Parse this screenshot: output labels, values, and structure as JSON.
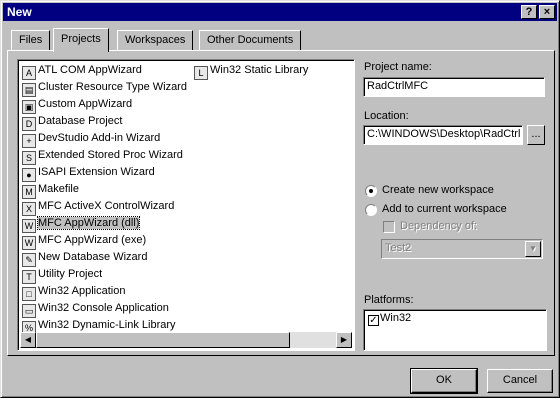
{
  "window": {
    "title": "New",
    "help_glyph": "?",
    "close_glyph": "×"
  },
  "tabs": [
    {
      "label": "Files"
    },
    {
      "label": "Projects"
    },
    {
      "label": "Workspaces"
    },
    {
      "label": "Other Documents"
    }
  ],
  "active_tab": "Projects",
  "project_types": [
    {
      "label": "ATL COM AppWizard",
      "icon": "atl-com-icon"
    },
    {
      "label": "Cluster Resource Type Wizard",
      "icon": "cluster-icon"
    },
    {
      "label": "Custom AppWizard",
      "icon": "custom-appwizard-icon"
    },
    {
      "label": "Database Project",
      "icon": "database-icon"
    },
    {
      "label": "DevStudio Add-in Wizard",
      "icon": "addin-icon"
    },
    {
      "label": "Extended Stored Proc Wizard",
      "icon": "stored-proc-icon"
    },
    {
      "label": "ISAPI Extension Wizard",
      "icon": "isapi-icon"
    },
    {
      "label": "Makefile",
      "icon": "makefile-icon"
    },
    {
      "label": "MFC ActiveX ControlWizard",
      "icon": "activex-icon"
    },
    {
      "label": "MFC AppWizard (dll)",
      "icon": "mfc-dll-icon"
    },
    {
      "label": "MFC AppWizard (exe)",
      "icon": "mfc-exe-icon"
    },
    {
      "label": "New Database Wizard",
      "icon": "new-database-icon"
    },
    {
      "label": "Utility Project",
      "icon": "utility-icon"
    },
    {
      "label": "Win32 Application",
      "icon": "win32-app-icon"
    },
    {
      "label": "Win32 Console Application",
      "icon": "console-icon"
    },
    {
      "label": "Win32 Dynamic-Link Library",
      "icon": "dll-icon"
    },
    {
      "label": "Win32 Static Library",
      "icon": "static-lib-icon"
    }
  ],
  "selected_project": "MFC AppWizard (dll)",
  "project_name": {
    "label": "Project name:",
    "value": "RadCtrlMFC"
  },
  "location": {
    "label": "Location:",
    "value": "C:\\WINDOWS\\Desktop\\RadCtrl",
    "browse_label": "..."
  },
  "workspace": {
    "create_new_label": "Create new workspace",
    "add_current_label": "Add to current workspace",
    "dependency_label": "Dependency of:",
    "dependency_value": "Test2",
    "selected": "create_new"
  },
  "platforms": {
    "label": "Platforms:",
    "items": [
      {
        "label": "Win32",
        "checked": true
      }
    ]
  },
  "buttons": {
    "ok": "OK",
    "cancel": "Cancel"
  },
  "colors": {
    "title_bar": "#000080",
    "face": "#c0c0c0"
  }
}
